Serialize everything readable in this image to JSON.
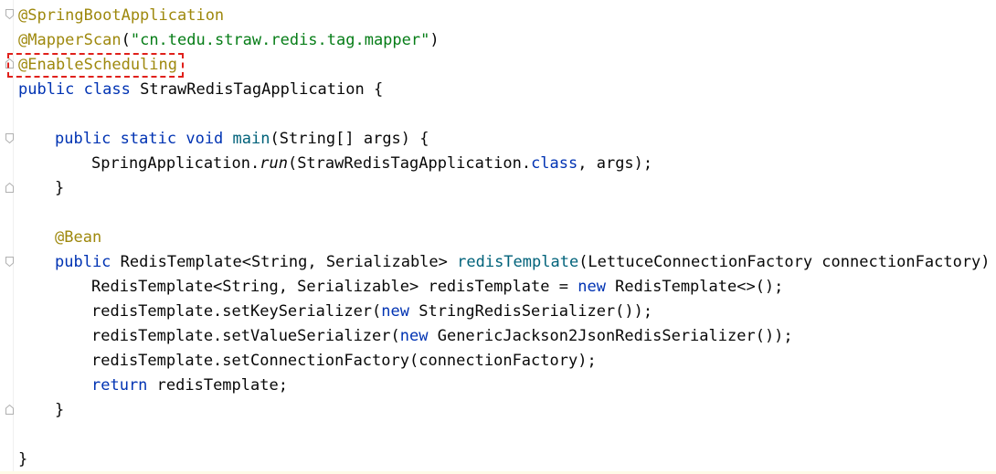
{
  "code": {
    "l1": {
      "ann": "@SpringBootApplication"
    },
    "l2": {
      "ann": "@MapperScan",
      "p1": "(",
      "str": "\"cn.tedu.straw.redis.tag.mapper\"",
      "p2": ")"
    },
    "l3": {
      "ann": "@EnableScheduling"
    },
    "l4": {
      "kw1": "public",
      "kw2": "class",
      "rest": " StrawRedisTagApplication {"
    },
    "l6": {
      "kw1": "public",
      "kw2": "static",
      "kw3": "void",
      "fn": "main",
      "rest": "(String[] args) {"
    },
    "l7": {
      "a": "SpringApplication.",
      "it": "run",
      "b": "(StrawRedisTagApplication.",
      "kw": "class",
      "c": ", args);"
    },
    "l8": {
      "text": "}"
    },
    "l10": {
      "ann": "@Bean"
    },
    "l11": {
      "kw": "public",
      "a": " RedisTemplate<String, Serializable> ",
      "fn": "redisTemplate",
      "b": "(LettuceConnectionFactory connectionFactory) {"
    },
    "l12": {
      "a": "RedisTemplate<String, Serializable> redisTemplate = ",
      "kw": "new",
      "b": " RedisTemplate<>();"
    },
    "l13": {
      "a": "redisTemplate.setKeySerializer(",
      "kw": "new",
      "b": " StringRedisSerializer());"
    },
    "l14": {
      "a": "redisTemplate.setValueSerializer(",
      "kw": "new",
      "b": " GenericJackson2JsonRedisSerializer());"
    },
    "l15": {
      "a": "redisTemplate.setConnectionFactory(connectionFactory);"
    },
    "l16": {
      "kw": "return",
      "a": " redisTemplate;"
    },
    "l17": {
      "text": "}"
    },
    "l19": {
      "text": "}"
    }
  },
  "colors": {
    "keyword": "#0033b3",
    "annotation": "#9e880d",
    "string": "#067d17",
    "method": "#00627a",
    "highlight_border": "#e0201b"
  },
  "icons": [
    "fold-start-icon",
    "fold-end-icon"
  ]
}
